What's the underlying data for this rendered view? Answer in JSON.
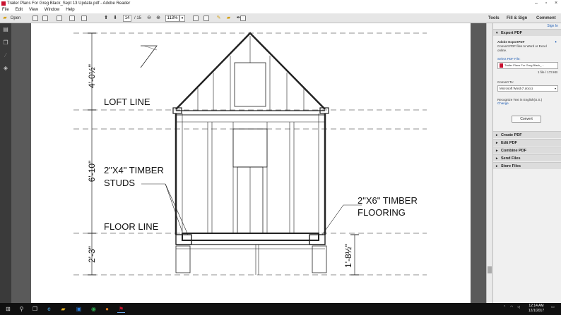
{
  "window": {
    "title": "Trailer Plans For Greg Black_Sept 13 Update.pdf - Adobe Reader"
  },
  "menu": [
    "File",
    "Edit",
    "View",
    "Window",
    "Help"
  ],
  "toolbar": {
    "open_label": "Open",
    "page_current": "14",
    "page_total": "/ 15",
    "zoom": "113%"
  },
  "right_tabs": {
    "tools": "Tools",
    "fill_sign": "Fill & Sign",
    "comment": "Comment"
  },
  "panel": {
    "sign_in": "Sign In",
    "export_header": "Export PDF",
    "export_title": "Adobe ExportPDF",
    "export_desc": "Convert PDF files to Word or Excel online.",
    "select_label": "Select PDF File:",
    "file_name": "Trailer Plans For Greg Black_...",
    "file_count": "1 file / 173 KB",
    "convert_to_label": "Convert To:",
    "convert_to_value": "Microsoft Word (*.docx)",
    "recognize": "Recognize Text in English(U.S.)",
    "change": "Change",
    "convert_button": "Convert",
    "sections": [
      "Create PDF",
      "Edit PDF",
      "Combine PDF",
      "Send Files",
      "Store Files"
    ]
  },
  "drawing": {
    "dim_top": "4'-0½\"",
    "dim_mid": "6'-10\"",
    "dim_low": "2'-3\"",
    "dim_right": "1'-8½\"",
    "loft_line": "LOFT LINE",
    "floor_line": "FLOOR LINE",
    "studs_1": "2\"X4\" TIMBER",
    "studs_2": "STUDS",
    "flooring_1": "2\"X6\" TIMBER",
    "flooring_2": "FLOORING"
  },
  "taskbar": {
    "time": "12:14 AM",
    "date": "12/1/2017"
  },
  "icons": {
    "start": "windows-start-icon",
    "search": "search-icon",
    "taskview": "task-view-icon",
    "accent": "#c8102e"
  }
}
